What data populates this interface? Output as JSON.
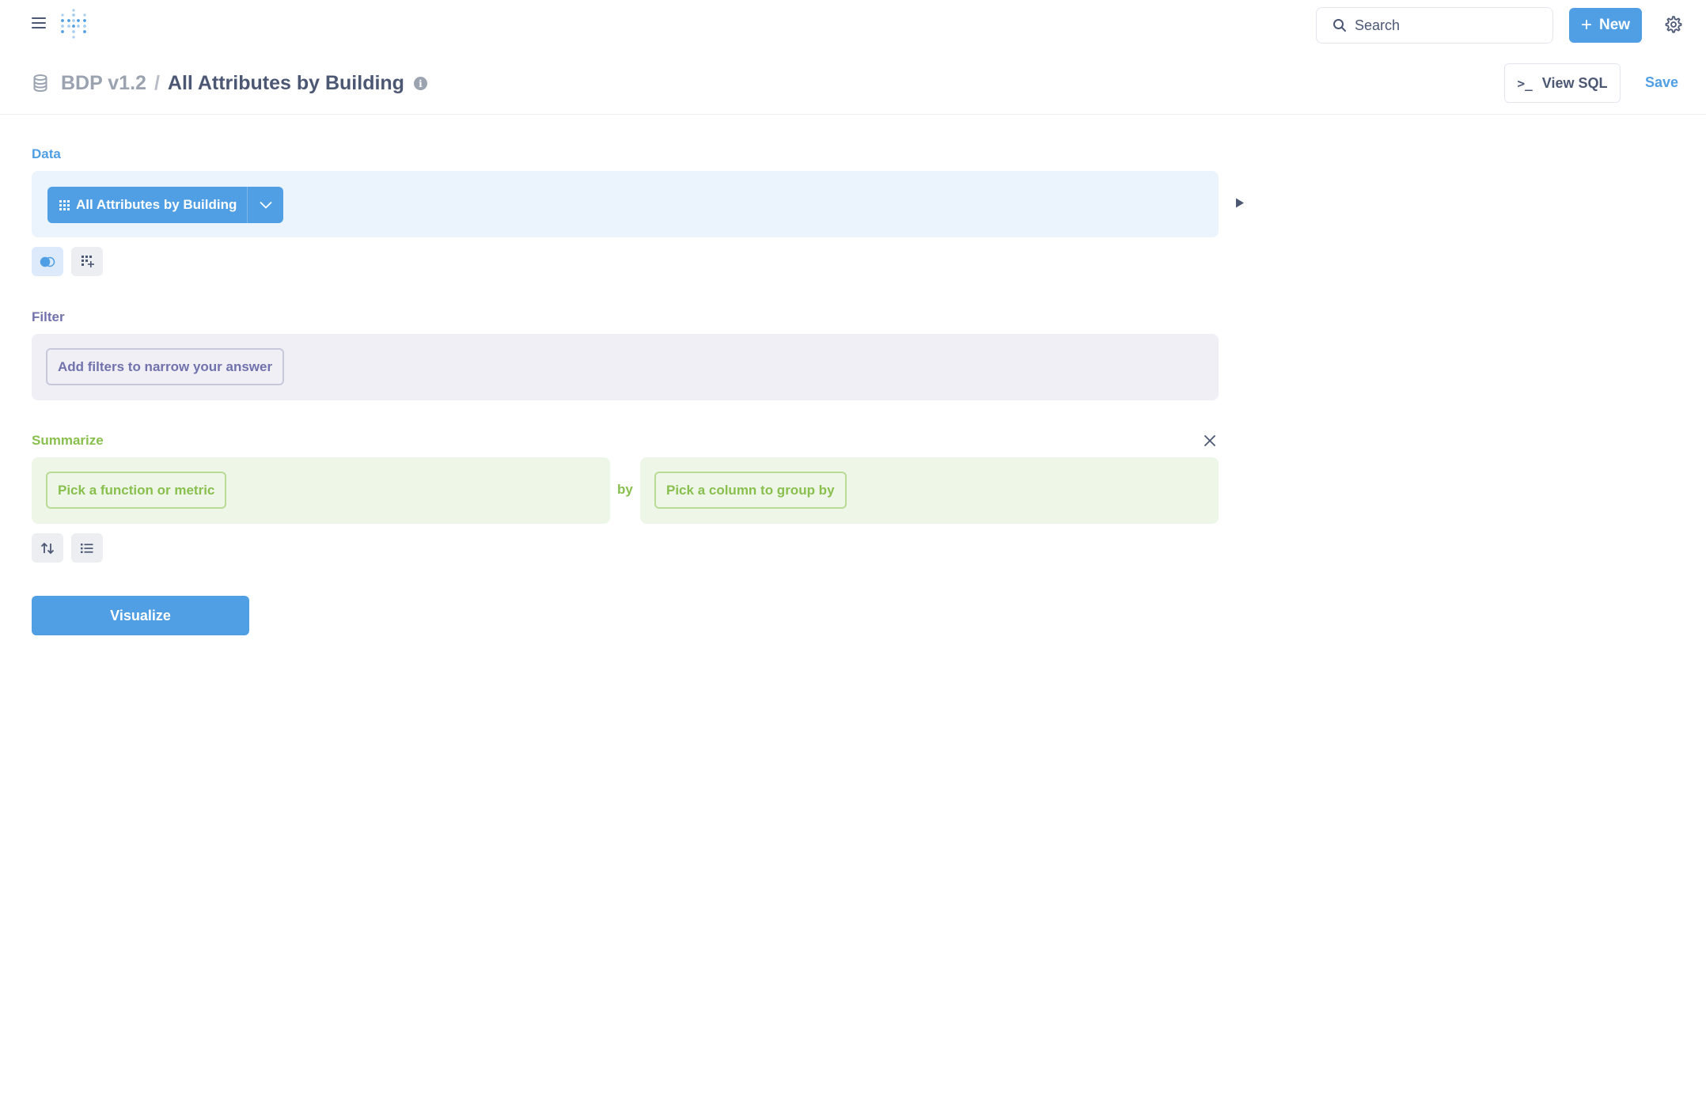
{
  "nav": {
    "search_placeholder": "Search",
    "new_label": "New"
  },
  "header": {
    "database": "BDP v1.2",
    "separator": "/",
    "title": "All Attributes by Building",
    "view_sql_label": "View SQL",
    "save_label": "Save"
  },
  "notebook": {
    "data": {
      "label": "Data",
      "source": "All Attributes by Building"
    },
    "filter": {
      "label": "Filter",
      "placeholder": "Add filters to narrow your answer"
    },
    "summarize": {
      "label": "Summarize",
      "metric_placeholder": "Pick a function or metric",
      "by": "by",
      "group_placeholder": "Pick a column to group by"
    },
    "visualize_label": "Visualize"
  },
  "colors": {
    "brand": "#509ee3",
    "filter": "#7172ad",
    "summarize": "#88bf4d",
    "text": "#4c5773"
  },
  "icons": [
    "hamburger-icon",
    "metabase-logo",
    "search-icon",
    "plus-icon",
    "gear-icon",
    "database-icon",
    "info-icon",
    "terminal-icon",
    "grid-icon",
    "chevron-down-icon",
    "play-icon",
    "join-icon",
    "custom-column-icon",
    "close-icon",
    "sort-icon",
    "limit-icon"
  ]
}
